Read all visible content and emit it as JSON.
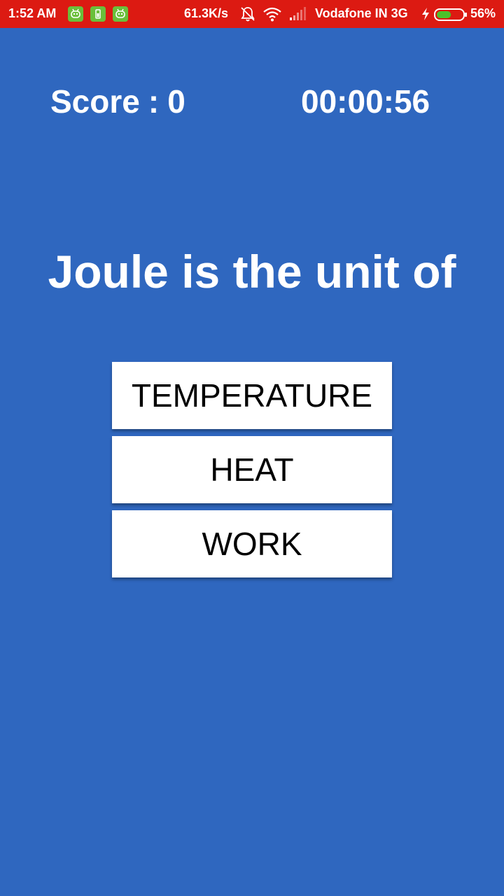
{
  "status_bar": {
    "time": "1:52 AM",
    "network_speed": "61.3K/s",
    "carrier": "Vodafone IN 3G",
    "battery_percent": "56%",
    "battery_level": 0.56,
    "icons": [
      "app-notification-icon",
      "battery-app-icon",
      "app-notification-icon",
      "mute-bell-icon",
      "wifi-icon",
      "signal-icon",
      "charging-icon",
      "battery-icon"
    ],
    "background_color": "#dc1a12"
  },
  "header": {
    "score_label": "Score",
    "score_separator": ":",
    "score_value": "0",
    "timer": "00:00:56"
  },
  "quiz": {
    "question": "Joule is the unit of",
    "options": [
      {
        "label": "TEMPERATURE"
      },
      {
        "label": "HEAT"
      },
      {
        "label": "WORK"
      }
    ]
  },
  "theme": {
    "background": "#2f67bf",
    "option_background": "#ffffff",
    "text_on_background": "#ffffff",
    "option_text": "#000000"
  }
}
